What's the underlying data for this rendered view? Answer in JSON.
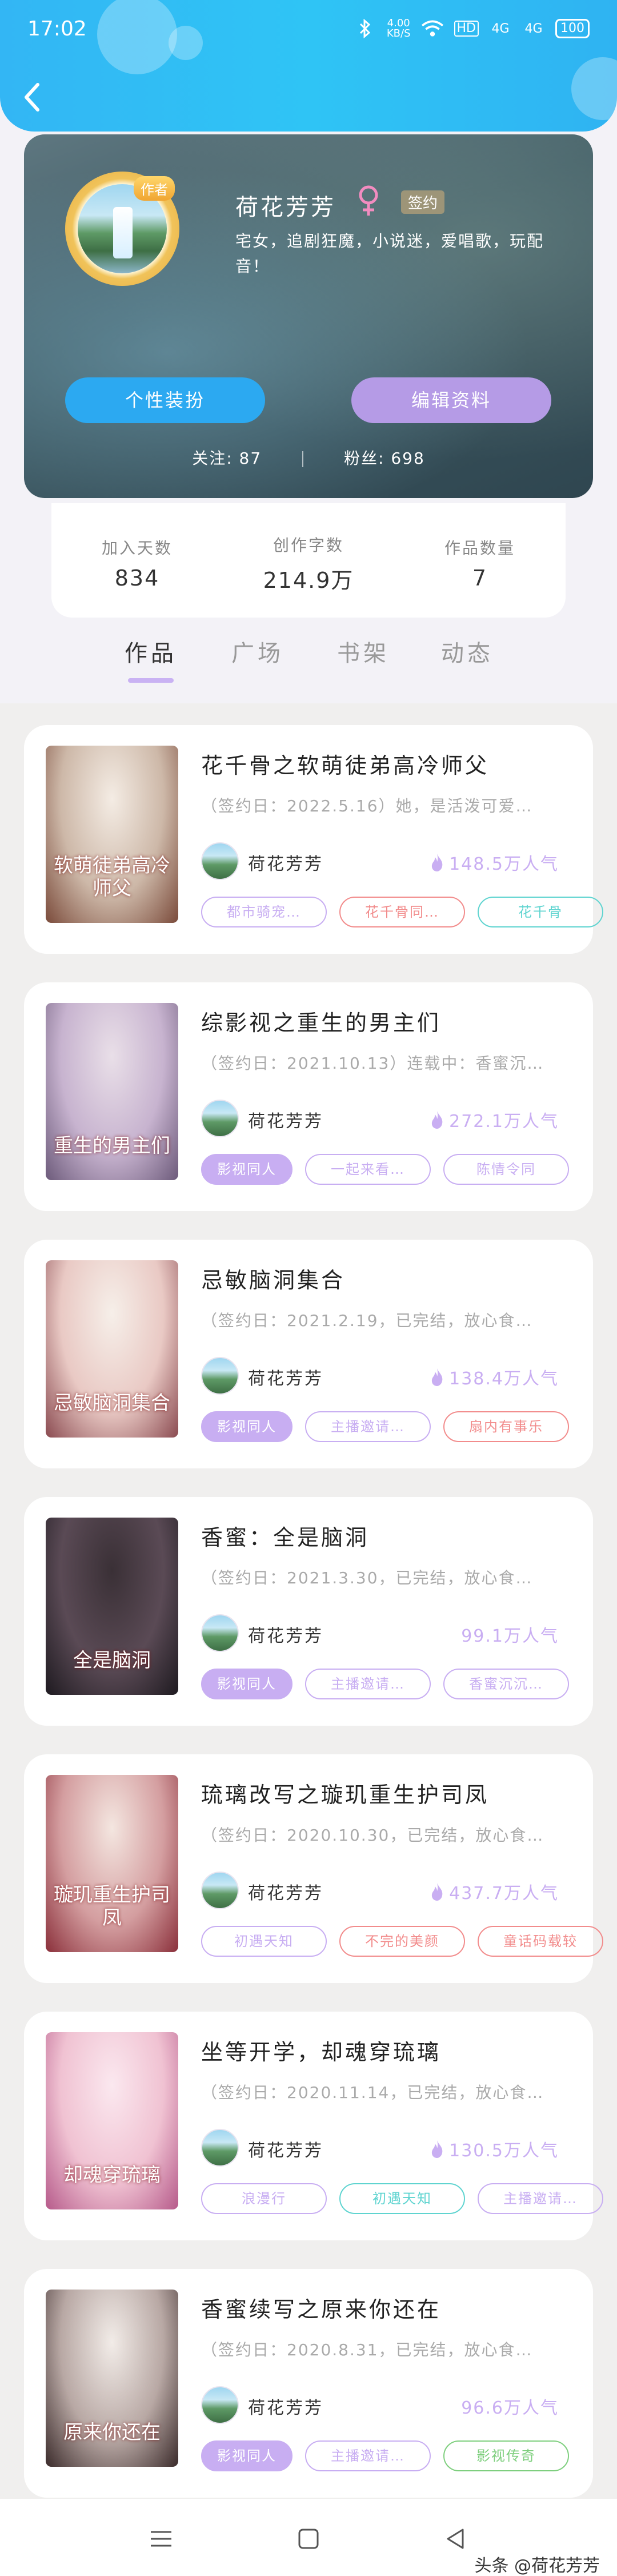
{
  "status_bar": {
    "time": "17:02",
    "net_speed": "4.00\nKB/S",
    "hd": "HD",
    "signal1": "4G",
    "signal2": "4G",
    "battery": "100"
  },
  "profile": {
    "author_badge": "作者",
    "name": "荷花芳芳",
    "sign_badge": "签约",
    "bio": "宅女，追剧狂魔，小说迷，爱唱歌，玩配音！",
    "outfit_button": "个性装扮",
    "edit_button": "编辑资料",
    "following": "关注: 87",
    "fans": "粉丝: 698"
  },
  "stats": [
    {
      "label": "加入天数",
      "value": "834"
    },
    {
      "label": "创作字数",
      "value": "214.9万"
    },
    {
      "label": "作品数量",
      "value": "7"
    }
  ],
  "tabs": [
    {
      "label": "作品",
      "active": true
    },
    {
      "label": "广场",
      "active": false
    },
    {
      "label": "书架",
      "active": false
    },
    {
      "label": "动态",
      "active": false
    }
  ],
  "books": [
    {
      "title": "花千骨之软萌徒弟高冷师父",
      "desc": "（签约日：2022.5.16）她，是活泼可爱…",
      "author": "荷花芳芳",
      "popularity": "148.5万人气",
      "hot": true,
      "cover_text": "软萌徒弟高冷师父",
      "cover_colors": [
        "#f4ece4",
        "#cdb8a8",
        "#7a4a3a"
      ],
      "tags": [
        {
          "label": "都市骑宠…",
          "color": "#c8aef2",
          "filled": false
        },
        {
          "label": "花千骨同…",
          "color": "#f28c8c",
          "filled": false
        },
        {
          "label": "花千骨",
          "color": "#5fd4d0",
          "filled": false
        }
      ]
    },
    {
      "title": "综影视之重生的男主们",
      "desc": "（签约日：2021.10.13）连载中：香蜜沉…",
      "author": "荷花芳芳",
      "popularity": "272.1万人气",
      "hot": true,
      "cover_text": "重生的男主们",
      "cover_colors": [
        "#e9dfe8",
        "#c7b3cf",
        "#6c5a7a"
      ],
      "tags": [
        {
          "label": "影视同人",
          "color": "#c8aef2",
          "filled": true
        },
        {
          "label": "一起来看…",
          "color": "#c8aef2",
          "filled": false
        },
        {
          "label": "陈情令同",
          "color": "#c8aef2",
          "filled": false
        }
      ]
    },
    {
      "title": "忌敏脑洞集合",
      "desc": "（签约日：2021.2.19，已完结，放心食…",
      "author": "荷花芳芳",
      "popularity": "138.4万人气",
      "hot": true,
      "cover_text": "忌敏脑洞集合",
      "cover_colors": [
        "#f6efe9",
        "#e9c9c4",
        "#8a4a50"
      ],
      "tags": [
        {
          "label": "影视同人",
          "color": "#c8aef2",
          "filled": true
        },
        {
          "label": "主播邀请…",
          "color": "#c8aef2",
          "filled": false
        },
        {
          "label": "扇内有事乐",
          "color": "#f28c8c",
          "filled": false
        }
      ]
    },
    {
      "title": "香蜜：全是脑洞",
      "desc": "（签约日：2021.3.30，已完结，放心食…",
      "author": "荷花芳芳",
      "popularity": "99.1万人气",
      "hot": false,
      "cover_text": "全是脑洞",
      "cover_colors": [
        "#3a3036",
        "#5a4a55",
        "#1e1a20"
      ],
      "tags": [
        {
          "label": "影视同人",
          "color": "#c8aef2",
          "filled": true
        },
        {
          "label": "主播邀请…",
          "color": "#c8aef2",
          "filled": false
        },
        {
          "label": "香蜜沉沉…",
          "color": "#c8aef2",
          "filled": false
        }
      ]
    },
    {
      "title": "琉璃改写之璇玑重生护司凤",
      "desc": "（签约日：2020.10.30，已完结，放心食…",
      "author": "荷花芳芳",
      "popularity": "437.7万人气",
      "hot": true,
      "cover_text": "璇玑重生护司凤",
      "cover_colors": [
        "#f4e6e0",
        "#d49ea0",
        "#8a2f3a"
      ],
      "tags": [
        {
          "label": "初遇天知",
          "color": "#c8aef2",
          "filled": false
        },
        {
          "label": "不完的美颜",
          "color": "#f28c8c",
          "filled": false
        },
        {
          "label": "童话码载较",
          "color": "#f28c8c",
          "filled": false
        }
      ]
    },
    {
      "title": "坐等开学，却魂穿琉璃",
      "desc": "（签约日：2020.11.14，已完结，放心食…",
      "author": "荷花芳芳",
      "popularity": "130.5万人气",
      "hot": true,
      "cover_text": "却魂穿琉璃",
      "cover_colors": [
        "#fbe8ef",
        "#f0c2d2",
        "#b65a8a"
      ],
      "tags": [
        {
          "label": "浪漫行",
          "color": "#c8aef2",
          "filled": false
        },
        {
          "label": "初遇天知",
          "color": "#5fd4d0",
          "filled": false
        },
        {
          "label": "主播邀请…",
          "color": "#c8aef2",
          "filled": false
        }
      ]
    },
    {
      "title": "香蜜续写之原来你还在",
      "desc": "（签约日：2020.8.31，已完结，放心食…",
      "author": "荷花芳芳",
      "popularity": "96.6万人气",
      "hot": false,
      "cover_text": "原来你还在",
      "cover_colors": [
        "#f2ece8",
        "#b8a8a4",
        "#3a2a2a"
      ],
      "tags": [
        {
          "label": "影视同人",
          "color": "#c8aef2",
          "filled": true
        },
        {
          "label": "主播邀请…",
          "color": "#c8aef2",
          "filled": false
        },
        {
          "label": "影视传奇",
          "color": "#7fcf7f",
          "filled": false
        }
      ]
    }
  ],
  "watermark": "头条 @荷花芳芳"
}
